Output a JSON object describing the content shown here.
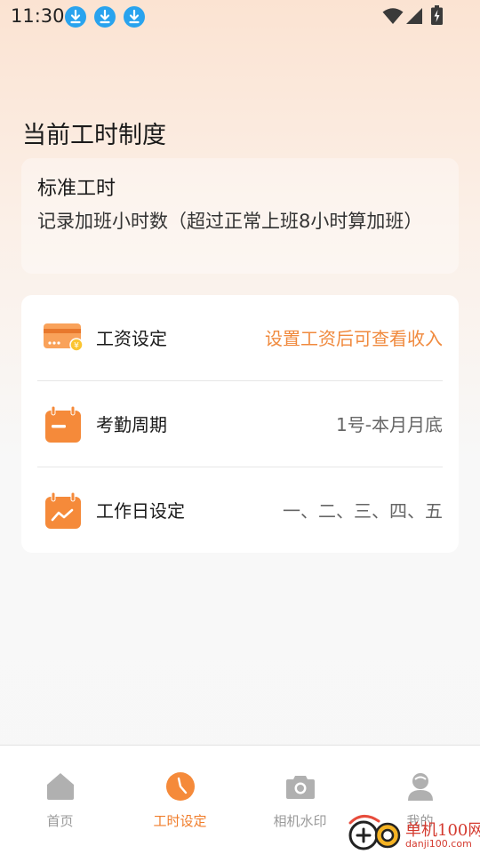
{
  "status_bar": {
    "time": "11:30",
    "notification_icons": [
      "download-icon",
      "download-icon",
      "download-icon"
    ],
    "system_icons": [
      "wifi-icon",
      "signal-icon",
      "battery-charging-icon"
    ]
  },
  "section": {
    "title": "当前工时制度"
  },
  "work_mode": {
    "title": "标准工时",
    "description": "记录加班小时数（超过正常上班8小时算加班）"
  },
  "settings": {
    "rows": [
      {
        "label": "工资设定",
        "value": "设置工资后可查看收入",
        "icon": "wallet-icon"
      },
      {
        "label": "考勤周期",
        "value": "1号-本月月底",
        "icon": "calendar-icon"
      },
      {
        "label": "工作日设定",
        "value": "一、二、三、四、五",
        "icon": "calendar-chart-icon"
      }
    ]
  },
  "bottom_nav": {
    "items": [
      {
        "label": "首页",
        "icon": "home-icon",
        "active": false
      },
      {
        "label": "工时设定",
        "icon": "clock-icon",
        "active": true
      },
      {
        "label": "相机水印",
        "icon": "camera-icon",
        "active": false
      },
      {
        "label": "我的",
        "icon": "profile-icon",
        "active": false
      }
    ]
  },
  "watermark": {
    "cn": "单机100网",
    "en": "danji100.com"
  },
  "colors": {
    "accent": "#f07d2b",
    "accent_light": "#f9a25a",
    "download_blue": "#29a3ee",
    "nav_inactive": "#b0b0b0"
  }
}
